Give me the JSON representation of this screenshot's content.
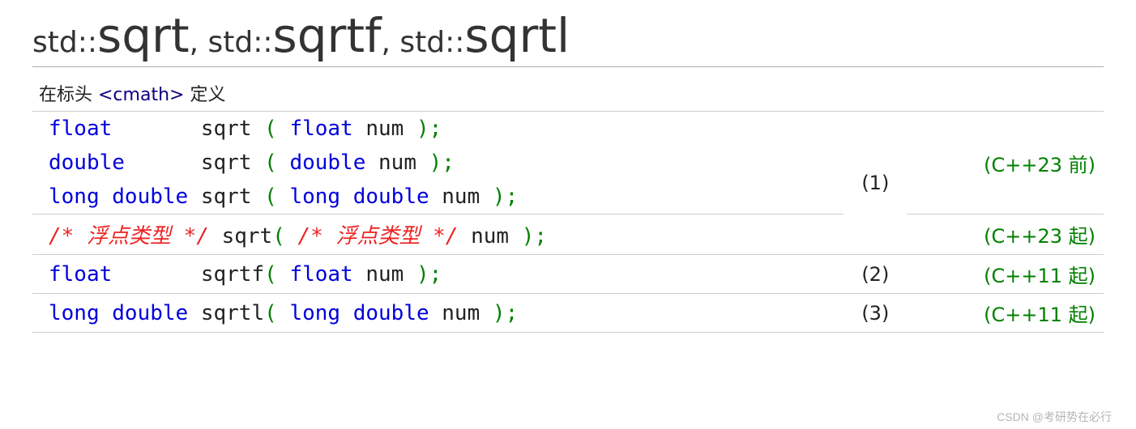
{
  "title": {
    "p1a": "std::",
    "p1b": "sqrt",
    "sep1": ", ",
    "p2a": "std::",
    "p2b": "sqrtf",
    "sep2": ", ",
    "p3a": "std::",
    "p3b": "sqrtl"
  },
  "header": {
    "prefix": "在标头 ",
    "link": "<cmath>",
    "suffix": " 定义"
  },
  "rows": {
    "r1": {
      "l1": {
        "t": "float       ",
        "fn": "sqrt ",
        "p1": "( ",
        "arg_t": "float ",
        "arg_n": "num ",
        "p2": ")",
        "sc": ";"
      },
      "l2": {
        "t": "double      ",
        "fn": "sqrt ",
        "p1": "( ",
        "arg_t": "double ",
        "arg_n": "num ",
        "p2": ")",
        "sc": ";"
      },
      "l3": {
        "t": "long double ",
        "fn": "sqrt ",
        "p1": "( ",
        "arg_t": "long double ",
        "arg_n": "num ",
        "p2": ")",
        "sc": ";"
      },
      "num": "(1)",
      "ver": "(C++23 前)"
    },
    "r2": {
      "l1": {
        "cm1": "/* 浮点类型 */",
        "sp1": " ",
        "fn": "sqrt",
        "p1": "( ",
        "cm2": "/* 浮点类型 */",
        "sp2": " ",
        "arg_n": "num ",
        "p2": ")",
        "sc": ";"
      },
      "num": "",
      "ver": "(C++23 起)"
    },
    "r3": {
      "l1": {
        "t": "float       ",
        "fn": "sqrtf",
        "p1": "( ",
        "arg_t": "float ",
        "arg_n": "num ",
        "p2": ")",
        "sc": ";"
      },
      "num": "(2)",
      "ver": "(C++11 起)"
    },
    "r4": {
      "l1": {
        "t": "long double ",
        "fn": "sqrtl",
        "p1": "( ",
        "arg_t": "long double ",
        "arg_n": "num ",
        "p2": ")",
        "sc": ";"
      },
      "num": "(3)",
      "ver": "(C++11 起)"
    }
  },
  "watermark": "CSDN @考研势在必行"
}
